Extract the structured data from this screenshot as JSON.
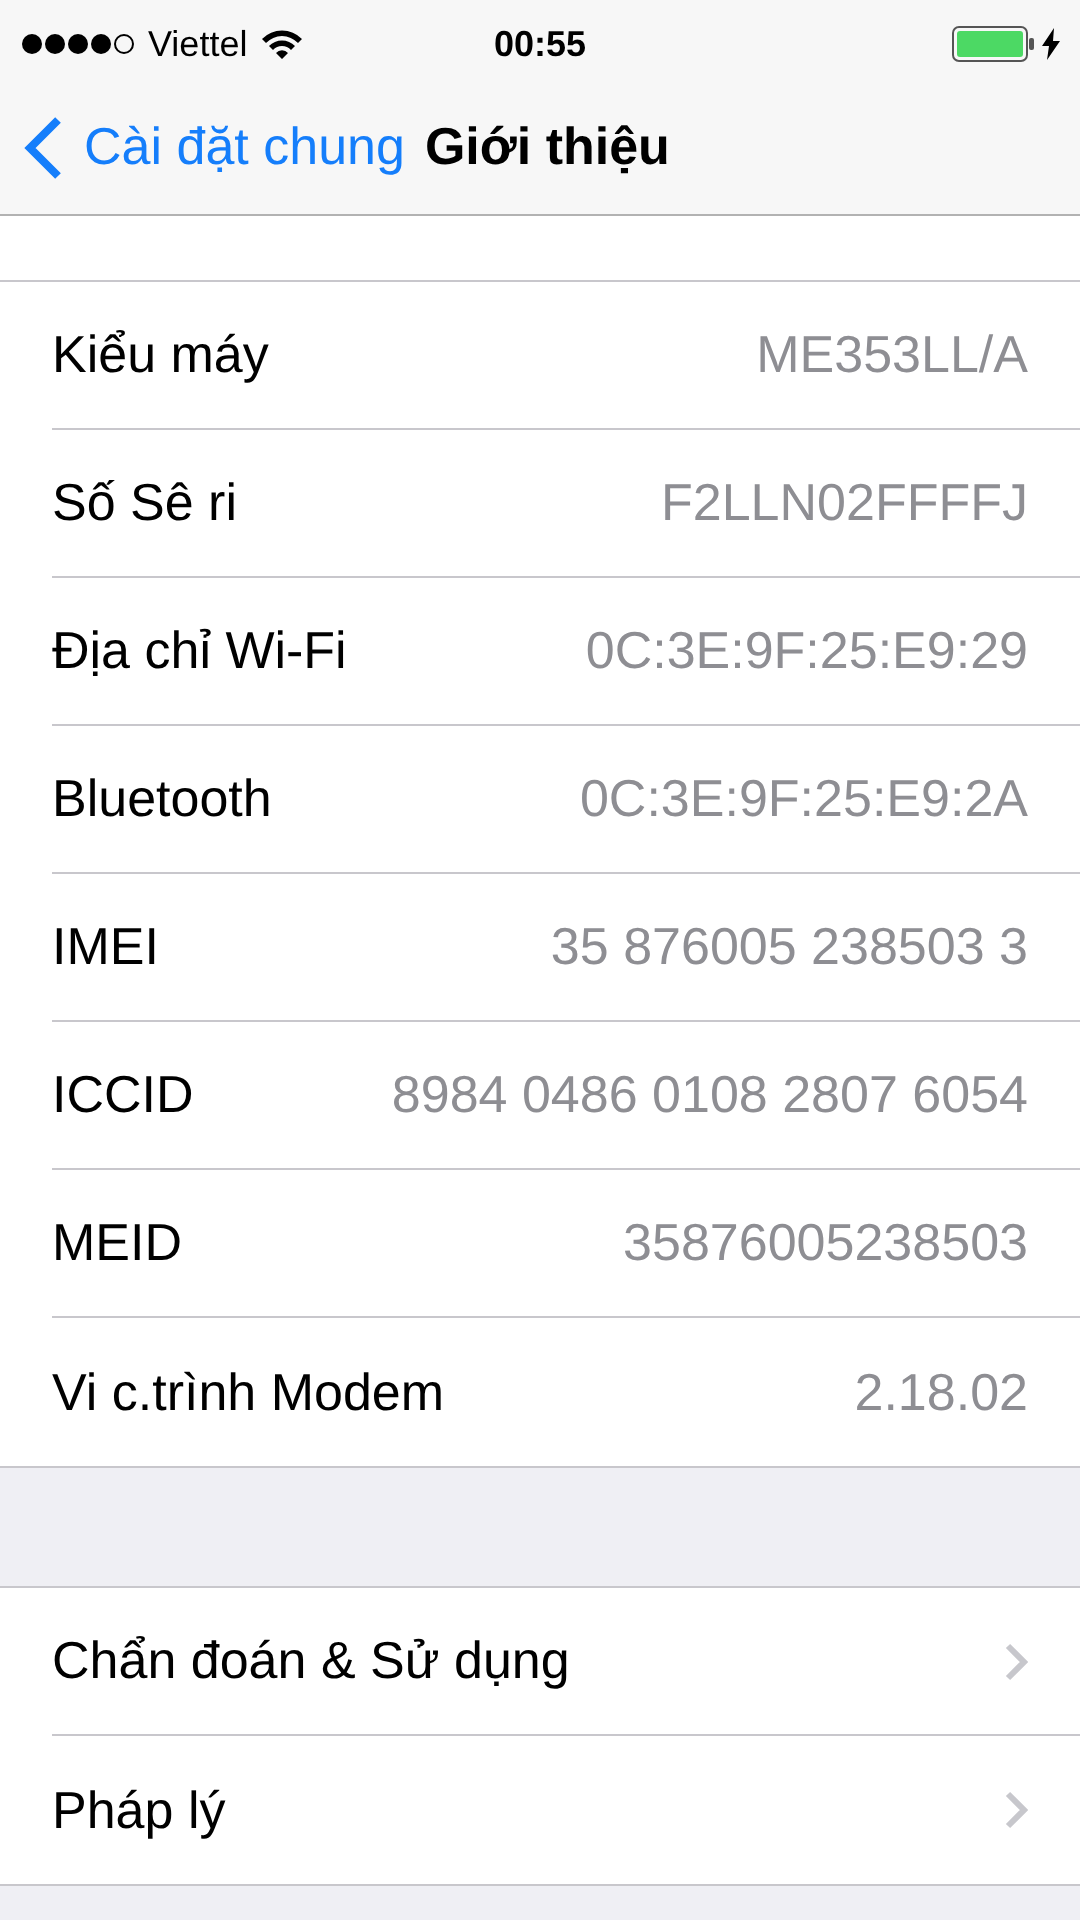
{
  "status_bar": {
    "carrier": "Viettel",
    "time": "00:55"
  },
  "nav_bar": {
    "back_label": "Cài đặt chung",
    "title": "Giới thiệu"
  },
  "info_rows": [
    {
      "label": "Kiểu máy",
      "value": "ME353LL/A"
    },
    {
      "label": "Số Sê ri",
      "value": "F2LLN02FFFFJ"
    },
    {
      "label": "Địa chỉ Wi-Fi",
      "value": "0C:3E:9F:25:E9:29"
    },
    {
      "label": "Bluetooth",
      "value": "0C:3E:9F:25:E9:2A"
    },
    {
      "label": "IMEI",
      "value": "35 876005 238503 3"
    },
    {
      "label": "ICCID",
      "value": "8984 0486 0108 2807 6054"
    },
    {
      "label": "MEID",
      "value": "35876005238503"
    },
    {
      "label": "Vi c.trình Modem",
      "value": "2.18.02"
    }
  ],
  "link_rows": [
    {
      "label": "Chẩn đoán & Sử dụng"
    },
    {
      "label": "Pháp lý"
    }
  ]
}
